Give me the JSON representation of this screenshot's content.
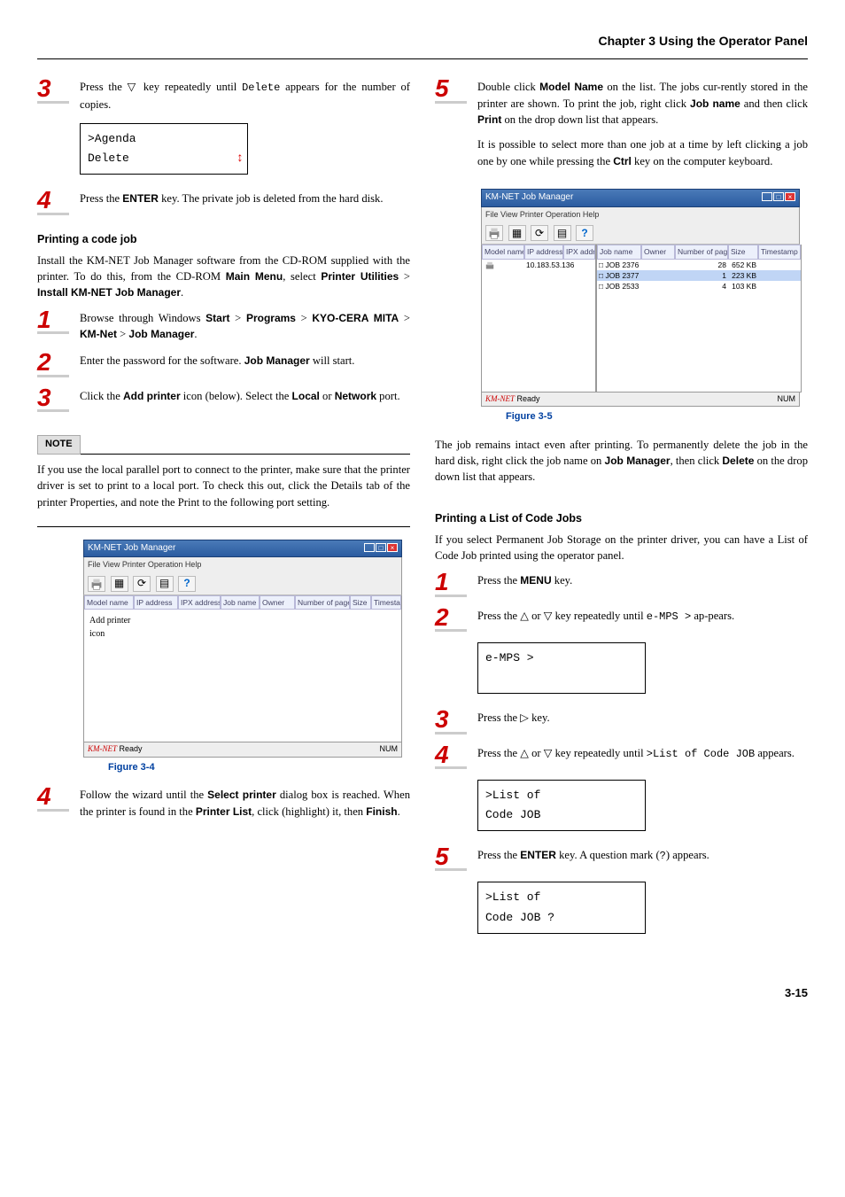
{
  "chapter": {
    "title": "Chapter 3  Using the Operator Panel"
  },
  "left": {
    "step3a": {
      "num": "3",
      "text_1": "Press the ▽ key repeatedly until ",
      "code": "Delete",
      "text_2": " appears for the number of copies."
    },
    "lcd1": {
      "l1": ">Agenda",
      "l2": " Delete"
    },
    "step4a": {
      "num": "4",
      "text_1": "Press the ",
      "b": "ENTER",
      "text_2": " key. The private job is deleted from the hard disk."
    },
    "h_codejob": "Printing a code job",
    "p_install_1": "Install the KM-NET Job Manager software from the CD-ROM supplied with the printer. To do this, from the CD-ROM ",
    "b_mainmenu": "Main Menu",
    "p_install_2": ", select ",
    "b_pu": "Printer Utilities",
    "gt1": " > ",
    "b_ikmn": "Install KM-NET Job Manager",
    "p_install_3": ".",
    "step1b": {
      "num": "1",
      "t1": "Browse through Windows ",
      "b1": "Start",
      "g1": " > ",
      "b2": "Programs",
      "g2": " > ",
      "b3": "KYO-CERA MITA",
      "g3": " > ",
      "b4": "KM-Net",
      "g4": " > ",
      "b5": "Job Manager",
      "t2": "."
    },
    "step2b": {
      "num": "2",
      "t1": "Enter the password for the software. ",
      "b1": "Job Manager",
      "t2": " will start."
    },
    "step3b": {
      "num": "3",
      "t1": "Click the ",
      "b1": "Add printer",
      "t2": " icon (below). Select the ",
      "b2": "Local",
      "t3": " or ",
      "b3": "Network",
      "t4": " port."
    },
    "note_hd": "NOTE",
    "note_body": "If you use the local parallel port to connect to the printer, make sure that the printer driver is set to print to a local port. To check this out, click the Details tab of the printer Properties, and note the Print to the following port setting.",
    "ss": {
      "title": "KM-NET Job Manager",
      "menu": "File   View   Printer   Operation   Help",
      "tool_help": "?",
      "cols": [
        "Model name",
        "IP address",
        "IPX address",
        "Job name",
        "Owner",
        "Number of pages",
        "Size",
        "Timestamp"
      ],
      "addp_label": "Add printer\nicon",
      "status_left": "Ready",
      "status_right": "NUM"
    },
    "fig4": "Figure 3-4",
    "step4b": {
      "num": "4",
      "t1": "Follow the wizard until the ",
      "b1": "Select printer",
      "t2": " dialog box is reached. When the printer is found in the ",
      "b2": "Printer List",
      "t3": ", click (highlight) it, then ",
      "b3": "Finish",
      "t4": "."
    }
  },
  "right": {
    "step5a": {
      "num": "5",
      "t1": "Double click ",
      "b1": "Model Name",
      "t2": " on the list. The jobs cur-rently stored in the printer are shown. To print the job, right click ",
      "b2": "Job name",
      "t3": " and then click ",
      "b3": "Print",
      "t4": " on the drop down list that appears."
    },
    "p_ctrl_1": "It is possible to select more than one job at a time by left clicking a job one by one while pressing the ",
    "b_ctrl": "Ctrl",
    "p_ctrl_2": " key on the computer keyboard.",
    "ss2": {
      "title": "KM-NET Job Manager",
      "menu": "File   View   Printer   Operation   Help",
      "cols_left": [
        "Model name",
        "IP address",
        "IPX address"
      ],
      "cols_right": [
        "Job name",
        "Owner",
        "Number of pages",
        "Size",
        "Timestamp"
      ],
      "ip": "10.183.53.136",
      "jobs": [
        {
          "name": "JOB 2376",
          "pages": "28",
          "size": "652 KB"
        },
        {
          "name": "JOB 2377",
          "pages": "1",
          "size": "223 KB"
        },
        {
          "name": "JOB 2533",
          "pages": "4",
          "size": "103 KB"
        }
      ],
      "status_left": "Ready",
      "status_right": "NUM"
    },
    "fig5": "Figure 3-5",
    "p_remains_1": "The job remains intact even after printing. To permanently delete the job in the hard disk, right click the job name on ",
    "b_jm": "Job Manager",
    "p_remains_2": ", then click ",
    "b_del": "Delete",
    "p_remains_3": " on the drop down list that appears.",
    "h_listcode": "Printing a List of Code Jobs",
    "p_perm": "If you select Permanent Job Storage on the printer driver, you can have a List of Code Job printed using the operator panel.",
    "s1": {
      "num": "1",
      "t1": "Press the ",
      "b1": "MENU",
      "t2": " key."
    },
    "s2": {
      "num": "2",
      "t1": "Press the △ or ▽ key repeatedly until ",
      "c1": "e-MPS  >",
      "t2": " ap-pears."
    },
    "lcd2": "e-MPS            >",
    "s3": {
      "num": "3",
      "t1": "Press the ▷ key."
    },
    "s4": {
      "num": "4",
      "t1": "Press the △ or ▽ key repeatedly until ",
      "c1": ">List  of Code JOB",
      "t2": " appears."
    },
    "lcd3a": ">List of",
    "lcd3b": " Code JOB",
    "s5": {
      "num": "5",
      "t1": "Press the ",
      "b1": "ENTER",
      "t2": " key. A question mark (",
      "c1": "?",
      "t3": ") appears."
    },
    "lcd4a": ">List of",
    "lcd4b": " Code JOB ?"
  },
  "pagenum": "3-15"
}
